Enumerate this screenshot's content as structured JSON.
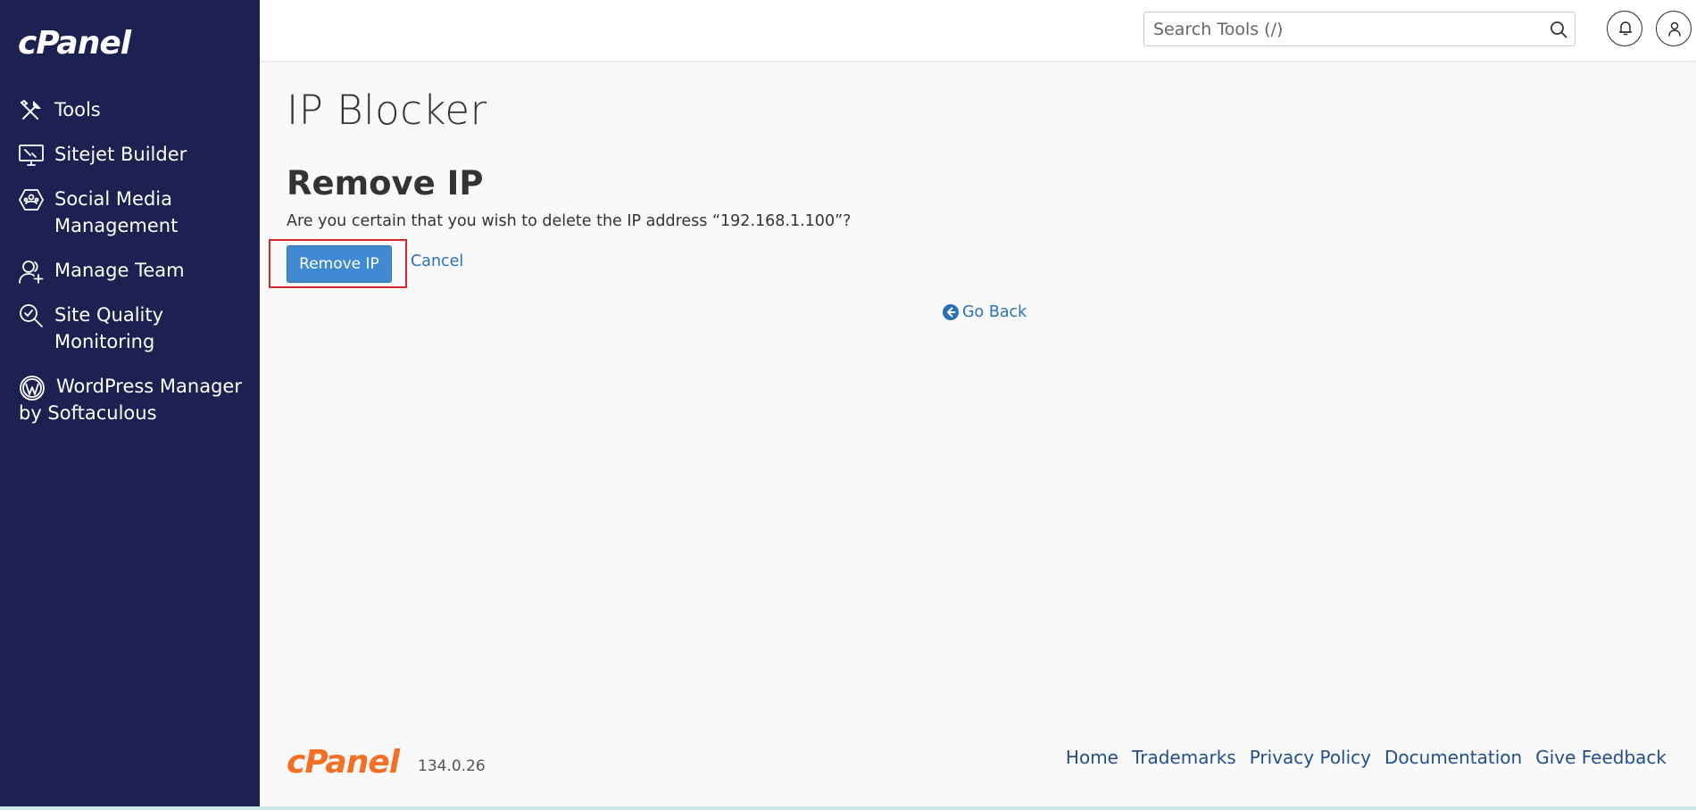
{
  "sidebar": {
    "brand": "cPanel",
    "items": [
      {
        "label": "Tools",
        "icon": "tools-icon"
      },
      {
        "label": "Sitejet Builder",
        "icon": "monitor-icon"
      },
      {
        "label": "Social Media Management",
        "icon": "social-media-icon"
      },
      {
        "label": "Manage Team",
        "icon": "team-icon"
      },
      {
        "label": "Site Quality Monitoring",
        "icon": "site-quality-icon"
      },
      {
        "label": "WordPress Manager by Softaculous",
        "icon": "wordpress-icon"
      }
    ]
  },
  "header": {
    "search_placeholder": "Search Tools (/)"
  },
  "main": {
    "page_title": "IP Blocker",
    "section_title": "Remove IP",
    "confirm_text": "Are you certain that you wish to delete the IP address “192.168.1.100”?",
    "remove_button": "Remove IP",
    "cancel_link": "Cancel",
    "go_back": "Go Back"
  },
  "footer": {
    "logo": "cPanel",
    "version": "134.0.26",
    "links": [
      "Home",
      "Trademarks",
      "Privacy Policy",
      "Documentation",
      "Give Feedback"
    ]
  },
  "colors": {
    "sidebar_bg": "#1d2152",
    "primary_button": "#3f8ad3",
    "link": "#2a72b7",
    "footer_link": "#224f8c",
    "footer_logo": "#f26f23",
    "highlight_border": "#d9262b"
  }
}
